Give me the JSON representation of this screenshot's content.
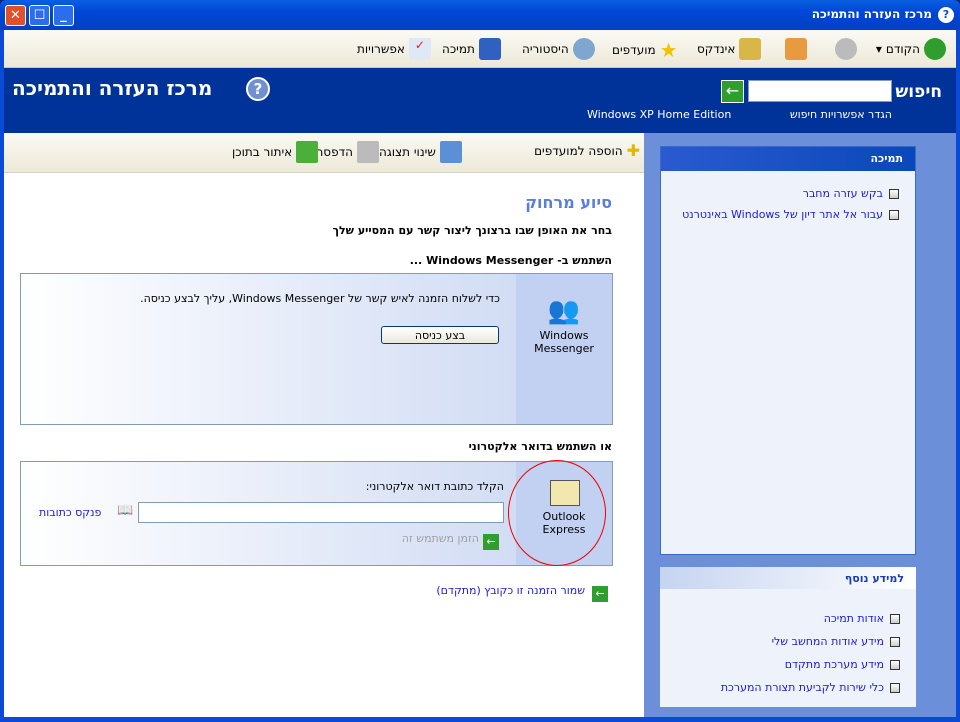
{
  "window": {
    "title": "מרכז העזרה והתמיכה"
  },
  "toolbar": {
    "back": "הקודם",
    "index": "אינדקס",
    "favorites": "מועדפים",
    "history": "היסטוריה",
    "support": "תמיכה",
    "options": "אפשרויות"
  },
  "header": {
    "search_label": "חיפוש",
    "search_value": "",
    "search_options": "הגדר אפשרויות חיפוש",
    "edition": "Windows XP Home Edition",
    "title": "מרכז העזרה והתמיכה"
  },
  "content_toolbar": {
    "add_favorites": "הוספה למועדפים",
    "change_view": "שינוי תצוגה",
    "print": "הדפסה...",
    "locate": "איתור בתוכן"
  },
  "content": {
    "heading": "סיוע מרחוק",
    "intro": "בחר את האופן שבו ברצונך ליצור קשר עם המסייע שלך",
    "messenger_heading": "השתמש ב- Windows Messenger ...",
    "messenger_text": "כדי לשלוח הזמנה לאיש קשר של Windows Messenger, עליך לבצע כניסה.",
    "signin_button": "בצע כניסה",
    "messenger_label": "Windows Messenger",
    "email_heading": "או השתמש בדואר אלקטרוני",
    "email_prompt": "הקלד כתובת דואר אלקטרוני:",
    "email_value": "",
    "address_book": "פנקס כתובות",
    "invite": "הזמן משתמש זה",
    "outlook_label": "Outlook Express",
    "save_invitation": "שמור הזמנה זו כקובץ (מתקדם)"
  },
  "sidebar": {
    "support_title": "תמיכה",
    "support_links": [
      "בקש עזרה מחבר",
      "עבור אל אתר דיון של Windows באינטרנט"
    ],
    "more_title": "למידע נוסף",
    "more_links": [
      "אודות תמיכה",
      "מידע אודות המחשב שלי",
      "מידע מערכת מתקדם",
      "כלי שירות לקביעת תצורת המערכת"
    ]
  }
}
